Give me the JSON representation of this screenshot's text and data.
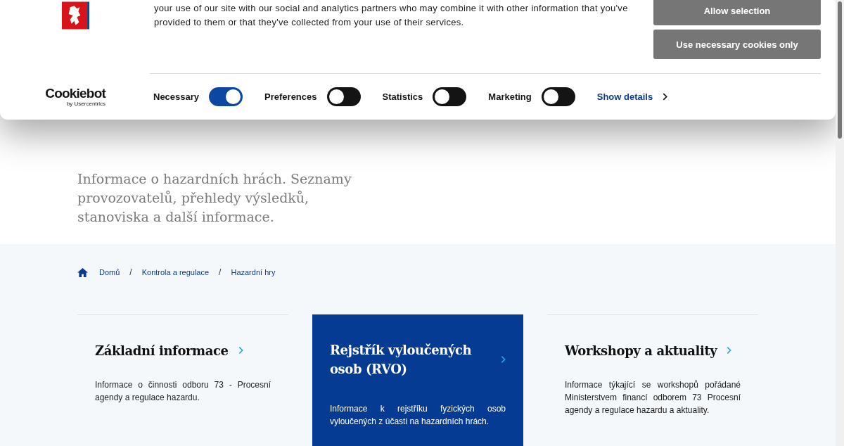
{
  "cookie_banner": {
    "text": "your use of our site with our social and analytics partners who may combine it with other information that you've provided to them or that they've collected from your use of their services.",
    "buttons": [
      "Allow selection",
      "Use necessary cookies only"
    ],
    "brand": {
      "name": "Cookiebot",
      "byline": "by Usercentrics"
    },
    "toggles": [
      {
        "label": "Necessary",
        "on": true
      },
      {
        "label": "Preferences",
        "on": false
      },
      {
        "label": "Statistics",
        "on": false
      },
      {
        "label": "Marketing",
        "on": false
      }
    ],
    "details_link": "Show details"
  },
  "hero": {
    "subtitle": "Informace o hazardních hrách. Seznamy provozovatelů, přehledy výsledků, stanoviska a další informace."
  },
  "breadcrumb": [
    {
      "kind": "link",
      "text": "Domů"
    },
    {
      "kind": "separator",
      "text": "/"
    },
    {
      "kind": "link",
      "text": "Kontrola a regulace"
    },
    {
      "kind": "separator",
      "text": "/"
    },
    {
      "kind": "link",
      "text": "Hazardní hry"
    }
  ],
  "cards": [
    {
      "title": "Základní informace",
      "text": "Informace o činnosti odboru 73 - Procesní agendy a regulace hazardu.",
      "selected": false
    },
    {
      "title": "Rejstřík vyloučených osob (RVO)",
      "text": "Informace k rejstříku fyzických osob vyloučených z účasti na hazardních hrách.",
      "selected": true
    },
    {
      "title": "Workshopy a aktuality",
      "text": "Informace týkající se workshopů pořádané Ministerstvem financí odborem 73 Procesní agendy a regulace hazardu a aktuality.",
      "selected": false
    }
  ]
}
